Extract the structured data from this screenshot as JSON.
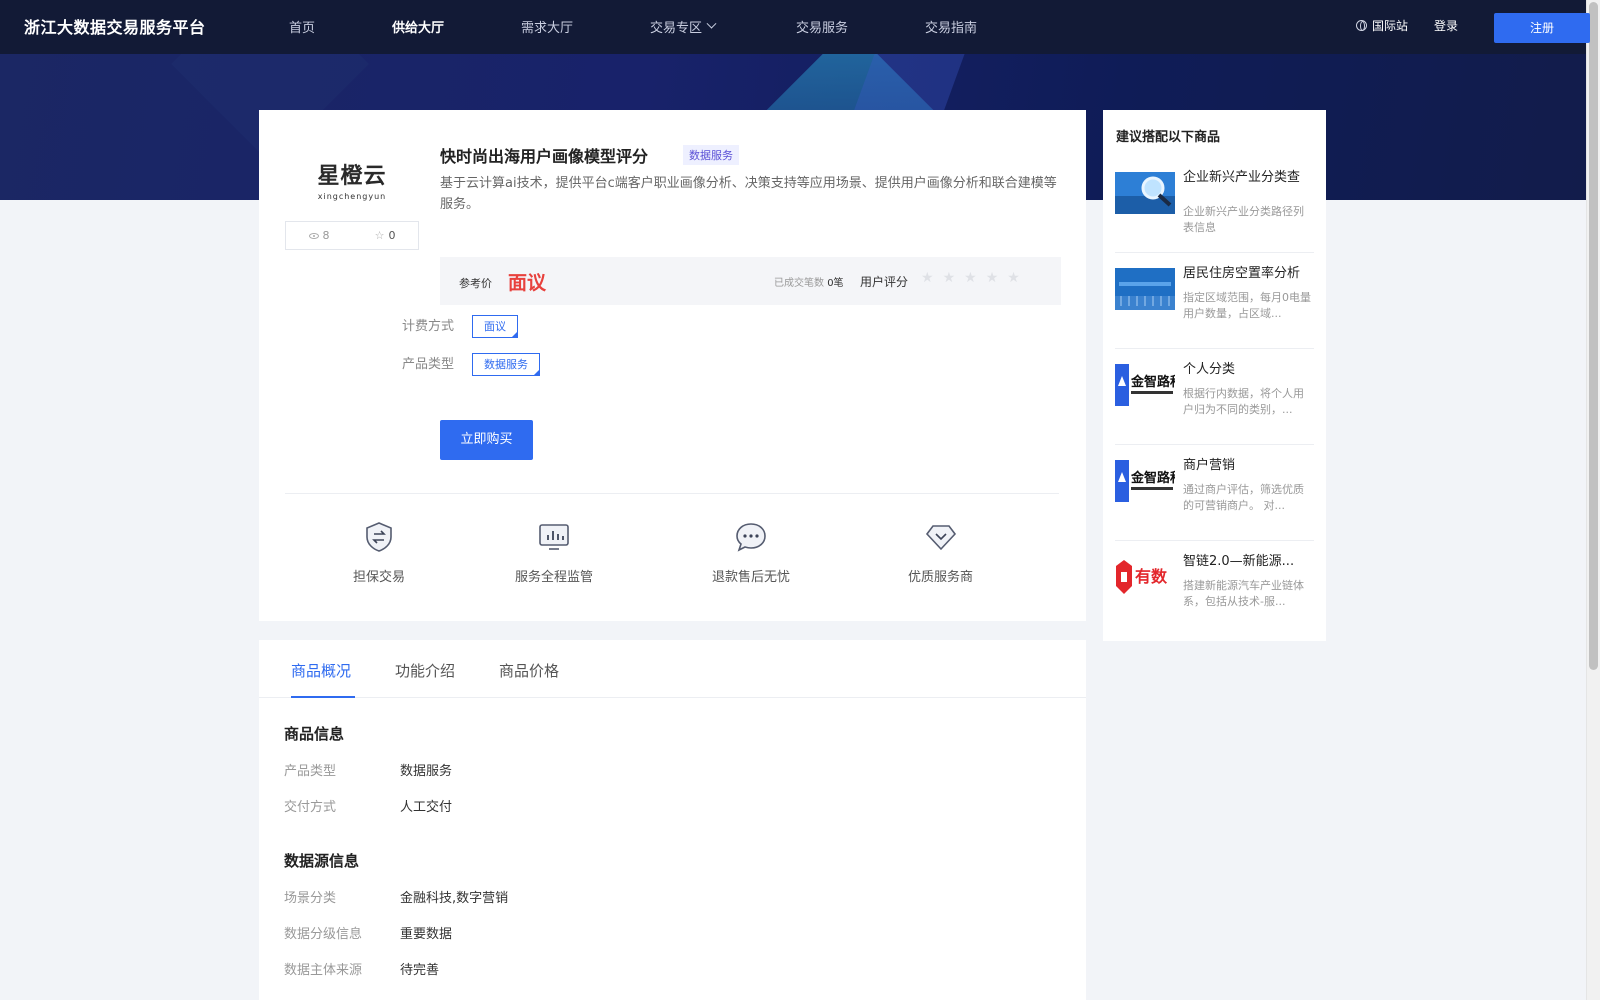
{
  "header": {
    "brand": "浙江大数据交易服务平台",
    "nav": [
      {
        "label": "首页",
        "active": false
      },
      {
        "label": "供给大厅",
        "active": true
      },
      {
        "label": "需求大厅",
        "active": false
      },
      {
        "label": "交易专区",
        "active": false,
        "has_dropdown": true
      },
      {
        "label": "交易服务",
        "active": false
      },
      {
        "label": "交易指南",
        "active": false
      }
    ],
    "intl_label": "国际站",
    "login_label": "登录",
    "register_label": "注册"
  },
  "product": {
    "logo_text": "星橙云",
    "logo_sub": "xingchengyun",
    "views": "8",
    "favorites": "0",
    "title": "快时尚出海用户画像模型评分",
    "badge": "数据服务",
    "description": "基于云计算ai技术，提供平台c端客户职业画像分析、决策支持等应用场景、提供用户画像分析和联合建模等服务。",
    "price_label": "参考价",
    "price_value": "面议",
    "deal_count_label": "已成交笔数",
    "deal_count_value": "0笔",
    "rating_label": "用户评分",
    "rating_value": 0,
    "rating_max": 5,
    "billing_label": "计费方式",
    "billing_value": "面议",
    "type_label": "产品类型",
    "type_value": "数据服务",
    "buy_label": "立即购买"
  },
  "guarantees": [
    {
      "label": "担保交易",
      "icon": "shield-exchange-icon"
    },
    {
      "label": "服务全程监管",
      "icon": "monitor-chart-icon"
    },
    {
      "label": "退款售后无忧",
      "icon": "chat-bubble-icon"
    },
    {
      "label": "优质服务商",
      "icon": "diamond-icon"
    }
  ],
  "tabs": [
    {
      "label": "商品概况",
      "active": true
    },
    {
      "label": "功能介绍",
      "active": false
    },
    {
      "label": "商品价格",
      "active": false
    }
  ],
  "info": {
    "product_section_title": "商品信息",
    "product_fields": [
      {
        "label": "产品类型",
        "value": "数据服务"
      },
      {
        "label": "交付方式",
        "value": "人工交付"
      }
    ],
    "source_section_title": "数据源信息",
    "source_fields": [
      {
        "label": "场景分类",
        "value": "金融科技,数字营销"
      },
      {
        "label": "数据分级信息",
        "value": "重要数据"
      },
      {
        "label": "数据主体来源",
        "value": "待完善"
      }
    ]
  },
  "sidebar": {
    "title": "建议搭配以下商品",
    "items": [
      {
        "name": "企业新兴产业分类查",
        "desc": "企业新兴产业分类路径列表信息",
        "thumb": "magnifier-thumb"
      },
      {
        "name": "居民住房空置率分析",
        "desc": "指定区域范围，每月0电量用户数量，占区域...",
        "thumb": "building-thumb"
      },
      {
        "name": "个人分类",
        "desc": "根据行内数据，将个人用户归为不同的类别，...",
        "thumb": "jinzhilu-logo",
        "logo_text": "金智路科技"
      },
      {
        "name": "商户营销",
        "desc": "通过商户评估，筛选优质的可营销商户。 对...",
        "thumb": "jinzhilu-logo",
        "logo_text": "金智路科技"
      },
      {
        "name": "智链2.0—新能源...",
        "desc": "搭建新能源汽车产业链体系，包括从技术-服...",
        "thumb": "youshu-logo",
        "logo_text": "有数"
      }
    ]
  },
  "colors": {
    "accent": "#2f6bf0",
    "price": "#e8413d",
    "navbar": "#121a36"
  }
}
